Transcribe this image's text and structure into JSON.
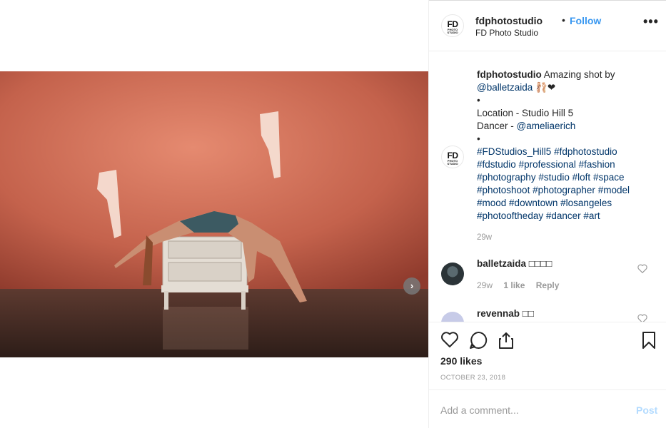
{
  "header": {
    "username": "fdphotostudio",
    "separator": "•",
    "follow_label": "Follow",
    "subtitle": "FD Photo Studio",
    "more_label": "•••",
    "avatar_text": "FD",
    "avatar_subtext": "PHOTO STUDIO"
  },
  "caption": {
    "username": "fdphotostudio",
    "line1": " Amazing shot by",
    "mention1": "@balletzaida",
    "emoji": " 🩰❤",
    "bullet1": "•",
    "location": "Location - Studio Hill 5",
    "dancer_prefix": "Dancer - ",
    "mention2": "@ameliaerich",
    "bullet2": "•",
    "hashtags": [
      "#FDStudios_Hill5",
      "#fdphotostudio",
      "#fdstudio",
      "#professional",
      "#fashion",
      "#photography",
      "#studio",
      "#loft",
      "#space",
      "#photoshoot",
      "#photographer",
      "#model",
      "#mood",
      "#downtown",
      "#losangeles",
      "#photooftheday",
      "#dancer",
      "#art"
    ],
    "time": "29w"
  },
  "comments": [
    {
      "username": "balletzaida",
      "text": " □□□□",
      "time": "29w",
      "likes": "1 like",
      "reply": "Reply"
    },
    {
      "username": "revennab",
      "text": " □□"
    }
  ],
  "actions": {
    "likes": "290 likes",
    "date": "OCTOBER 23, 2018"
  },
  "add_comment": {
    "placeholder": "Add a comment...",
    "post_label": "Post"
  },
  "media": {
    "next_label": "›"
  },
  "colors": {
    "accent": "#3897f0",
    "link": "#003569",
    "muted": "#999999",
    "post_disabled": "#b3dbff"
  }
}
